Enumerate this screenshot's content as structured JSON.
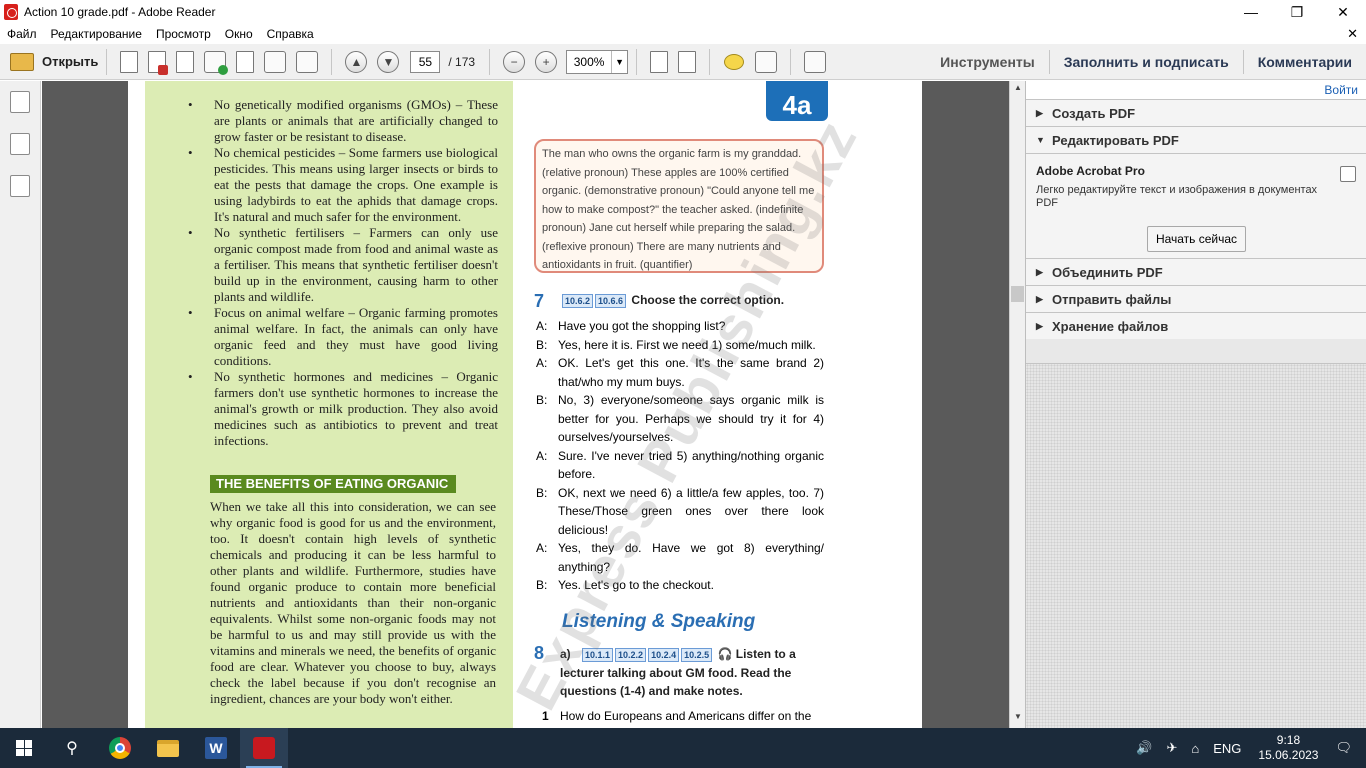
{
  "window": {
    "title": "Action 10 grade.pdf - Adobe Reader"
  },
  "menu": [
    "Файл",
    "Редактирование",
    "Просмотр",
    "Окно",
    "Справка"
  ],
  "toolbar": {
    "open_label": "Открыть",
    "page_current": "55",
    "page_total": "/ 173",
    "zoom": "300%",
    "tools_label": "Инструменты",
    "fill_sign_label": "Заполнить и подписать",
    "comments_label": "Комментарии"
  },
  "document": {
    "bullets": [
      "No genetically modified organisms (GMOs) – These are plants or animals that are artificially changed to grow faster or be resistant to disease.",
      "No chemical pesticides – Some farmers use biological pesticides. This means using larger insects or birds to eat the pests that damage the crops. One example is using ladybirds to eat the aphids that damage crops. It's natural and much safer for the environment.",
      "No synthetic fertilisers – Farmers can only use organic compost made from food and animal waste as a fertiliser. This means that synthetic fertiliser doesn't build up in the environment, causing harm to other plants and wildlife.",
      "Focus on animal welfare – Organic farming promotes animal welfare. In fact, the animals can only have organic feed and they must have good living conditions.",
      "No synthetic hormones and medicines – Organic farmers don't use synthetic hormones to increase the animal's growth or milk production. They also avoid medicines such as antibiotics to prevent and treat infections."
    ],
    "benefits_heading": "THE BENEFITS OF EATING ORGANIC",
    "benefits_text": "When we take all this into consideration, we can see why organic food is good for us and the environment, too. It doesn't contain high levels of synthetic chemicals and producing it can be less harmful to other plants and wildlife. Furthermore, studies have found organic produce to contain more beneficial nutrients and antioxidants than their non-organic equivalents. Whilst some non-organic foods may not be harmful to us and may still provide us with the vitamins and minerals we need, the benefits of organic food are clear. Whatever you choose to buy, always check the label because if you don't recognise an ingredient, chances are your body won't either.",
    "badge": "4a",
    "grammar_box": "The man who owns the organic farm is my granddad. (relative pronoun) These apples are 100% certified organic. (demonstrative pronoun) \"Could anyone tell me how to make compost?\" the teacher asked. (indefinite pronoun) Jane cut herself while preparing the salad. (reflexive pronoun) There are many nutrients and antioxidants in fruit. (quantifier)",
    "ex7_num": "7",
    "ex7_tags": [
      "10.6.2",
      "10.6.6"
    ],
    "ex7_title": "Choose the correct option.",
    "dialogue": [
      {
        "sp": "A:",
        "tx": "Have you got the shopping list?"
      },
      {
        "sp": "B:",
        "tx": "Yes, here it is. First we need 1) some/much milk."
      },
      {
        "sp": "A:",
        "tx": "OK. Let's get this one. It's the same brand 2) that/who my mum buys."
      },
      {
        "sp": "B:",
        "tx": "No, 3) everyone/someone says organic milk is better for you. Perhaps we should try it for 4) ourselves/yourselves."
      },
      {
        "sp": "A:",
        "tx": "Sure. I've never tried 5) anything/nothing organic before."
      },
      {
        "sp": "B:",
        "tx": "OK, next we need 6) a little/a few apples, too. 7) These/Those green ones over there look delicious!"
      },
      {
        "sp": "A:",
        "tx": "Yes, they do. Have we got 8) everything/ anything?"
      },
      {
        "sp": "B:",
        "tx": "Yes. Let's go to the checkout."
      }
    ],
    "ls_heading": "Listening & Speaking",
    "ex8_num": "8",
    "ex8_part": "a)",
    "ex8_tags": [
      "10.1.1",
      "10.2.2",
      "10.2.4",
      "10.2.5"
    ],
    "ex8_text": "Listen to a lecturer talking about GM food. Read the questions (1-4) and make notes.",
    "q1_num": "1",
    "q1_text": "How do Europeans and Americans differ on the",
    "watermark": "Express Publishing.kz"
  },
  "right_panel": {
    "login": "Войти",
    "sections": {
      "create": "Создать PDF",
      "edit": "Редактировать PDF",
      "combine": "Объединить PDF",
      "send": "Отправить файлы",
      "store": "Хранение файлов"
    },
    "product_title": "Adobe Acrobat Pro",
    "product_desc": "Легко редактируйте текст и изображения в документах PDF",
    "start_button": "Начать сейчас"
  },
  "taskbar": {
    "lang": "ENG",
    "time": "9:18",
    "date": "15.06.2023"
  }
}
